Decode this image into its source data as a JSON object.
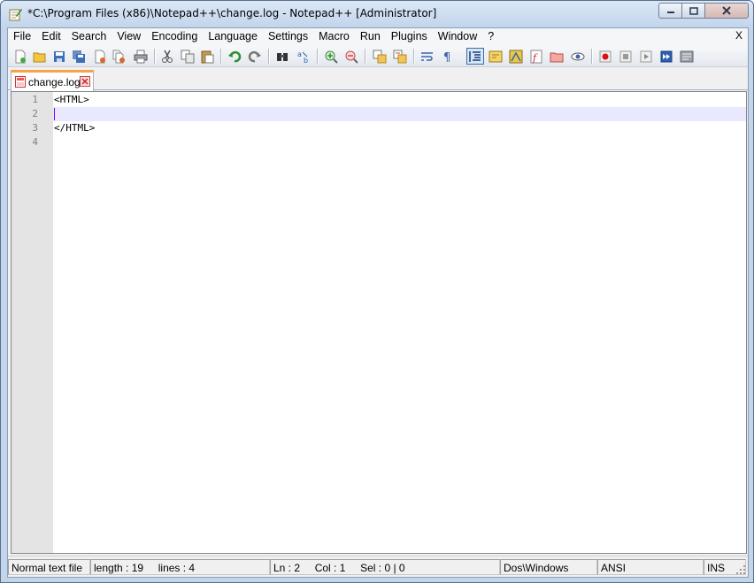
{
  "window": {
    "title": "*C:\\Program Files (x86)\\Notepad++\\change.log - Notepad++ [Administrator]",
    "controls": {
      "minimize": "minimize",
      "maximize": "maximize",
      "close": "close"
    }
  },
  "menubar": {
    "items": [
      "File",
      "Edit",
      "Search",
      "View",
      "Encoding",
      "Language",
      "Settings",
      "Macro",
      "Run",
      "Plugins",
      "Window",
      "?"
    ],
    "close_label": "X"
  },
  "toolbar": {
    "buttons": [
      {
        "icon": "new-file-icon"
      },
      {
        "icon": "open-file-icon"
      },
      {
        "icon": "save-icon"
      },
      {
        "icon": "save-all-icon"
      },
      {
        "icon": "close-file-icon"
      },
      {
        "icon": "close-all-icon"
      },
      {
        "icon": "print-icon"
      },
      {
        "icon": "cut-icon"
      },
      {
        "icon": "copy-icon"
      },
      {
        "icon": "paste-icon"
      },
      {
        "icon": "undo-icon"
      },
      {
        "icon": "redo-icon"
      },
      {
        "icon": "find-icon"
      },
      {
        "icon": "replace-icon"
      },
      {
        "icon": "zoom-in-icon"
      },
      {
        "icon": "zoom-out-icon"
      },
      {
        "icon": "sync-vertical-icon"
      },
      {
        "icon": "sync-horizontal-icon"
      },
      {
        "icon": "word-wrap-icon"
      },
      {
        "icon": "show-all-chars-icon"
      },
      {
        "icon": "indent-guide-icon"
      },
      {
        "icon": "udl-icon"
      },
      {
        "icon": "doc-map-icon"
      },
      {
        "icon": "function-list-icon"
      },
      {
        "icon": "folder-workspace-icon"
      },
      {
        "icon": "monitoring-icon"
      },
      {
        "icon": "record-macro-icon"
      },
      {
        "icon": "stop-macro-icon"
      },
      {
        "icon": "play-macro-icon"
      },
      {
        "icon": "run-macro-multiple-icon"
      },
      {
        "icon": "save-macro-icon"
      }
    ]
  },
  "tabs": [
    {
      "label": "change.log",
      "modified": true
    }
  ],
  "editor": {
    "line_numbers": [
      "1",
      "2",
      "3",
      "4"
    ],
    "lines": [
      "<HTML>",
      "",
      "</HTML>",
      ""
    ],
    "current_line": 2,
    "colors": {
      "current_line": "#e8e8ff",
      "caret": "#8000ff",
      "gutter": "#e4e4e4"
    }
  },
  "statusbar": {
    "file_type": "Normal text file",
    "length": "length : 19",
    "lines": "lines : 4",
    "ln": "Ln : 2",
    "col": "Col : 1",
    "sel": "Sel : 0 | 0",
    "eol": "Dos\\Windows",
    "encoding": "ANSI",
    "mode": "INS"
  }
}
